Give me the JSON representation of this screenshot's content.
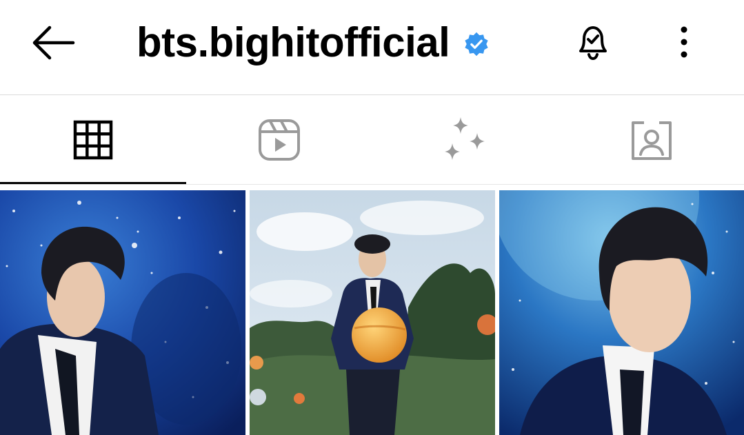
{
  "header": {
    "username": "bts.bighitofficial",
    "verified": true,
    "back_icon": "arrow-left-icon",
    "bell_icon": "bell-check-icon",
    "more_icon": "more-vertical-icon"
  },
  "tabs": [
    {
      "icon": "grid-icon",
      "active": true
    },
    {
      "icon": "reels-icon",
      "active": false
    },
    {
      "icon": "sparkles-icon",
      "active": false
    },
    {
      "icon": "tagged-icon",
      "active": false
    }
  ],
  "posts": [
    {
      "alt_icon": "post-photo-space-portrait"
    },
    {
      "alt_icon": "post-photo-planet-field"
    },
    {
      "alt_icon": "post-photo-space-closeup"
    }
  ],
  "colors": {
    "verified_blue": "#3897f0",
    "tab_inactive": "#9a9a9a",
    "divider": "#dbdbdb"
  }
}
